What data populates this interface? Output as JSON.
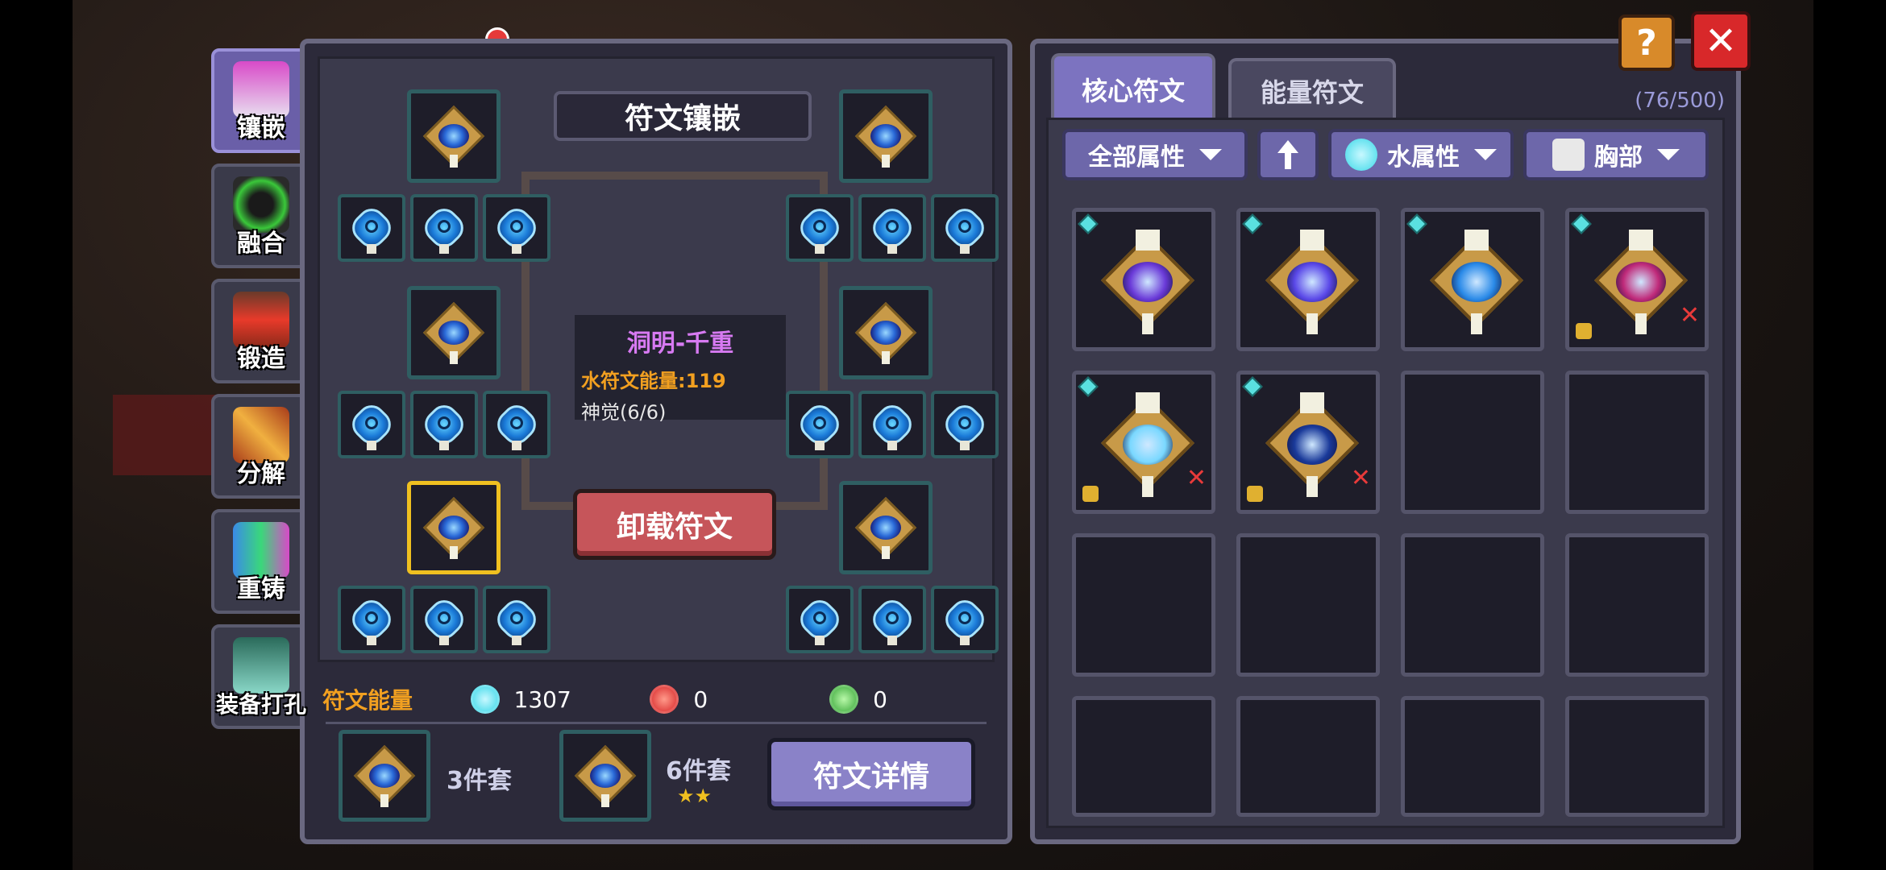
{
  "side_tabs": [
    {
      "label": "镶嵌",
      "active": true,
      "icon": "inlay-icon"
    },
    {
      "label": "融合",
      "active": false,
      "icon": "fusion-icon"
    },
    {
      "label": "锻造",
      "active": false,
      "icon": "forge-icon"
    },
    {
      "label": "分解",
      "active": false,
      "icon": "decompose-icon"
    },
    {
      "label": "重铸",
      "active": false,
      "icon": "recast-icon"
    },
    {
      "label": "装备打孔",
      "active": false,
      "icon": "equip-punch-icon"
    }
  ],
  "left_panel": {
    "title": "符文镶嵌",
    "rune_info": {
      "name": "洞明-千重",
      "energy": "水符文能量:119",
      "awakening": "神觉(6/6)"
    },
    "unload_button": "卸载符文",
    "energy": {
      "label": "符文能量",
      "water": "1307",
      "fire": "0",
      "wood": "0"
    },
    "sets": [
      {
        "label": "3件套",
        "stars": ""
      },
      {
        "label": "6件套",
        "stars": "★★"
      }
    ],
    "detail_button": "符文详情"
  },
  "right_panel": {
    "tabs": [
      "核心符文",
      "能量符文"
    ],
    "active_tab": 0,
    "count": "(76/500)",
    "filters": {
      "attribute": "全部属性",
      "element": "水属性",
      "slot": "胸部"
    }
  },
  "inventory": [
    {
      "core_color": "#6a3ad8",
      "new": true,
      "locked": false,
      "removable": false
    },
    {
      "core_color": "#5a48e8",
      "new": true,
      "locked": false,
      "removable": false
    },
    {
      "core_color": "#2a8ae8",
      "new": true,
      "locked": false,
      "removable": false
    },
    {
      "core_color": "#c02a7a",
      "new": true,
      "locked": true,
      "removable": true
    },
    {
      "core_color": "#7ad8ff",
      "new": true,
      "locked": true,
      "removable": true
    },
    {
      "core_color": "#1a3a9a",
      "new": true,
      "locked": true,
      "removable": true
    }
  ],
  "colors": {
    "accent": "#7c73c0",
    "unload": "#c6555a",
    "energy_label": "#f2a020",
    "rune_name": "#d77af2",
    "selected_slot": "#f0c020"
  }
}
